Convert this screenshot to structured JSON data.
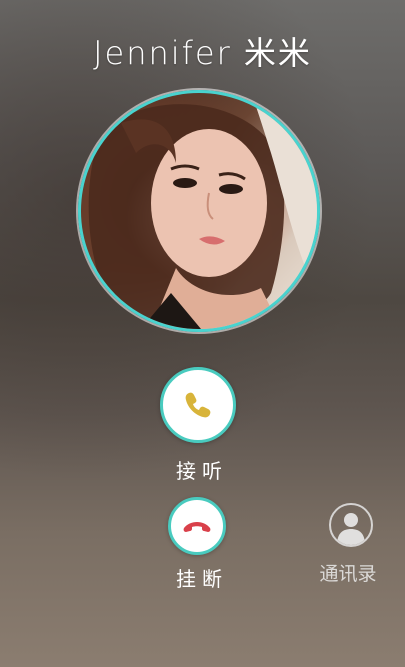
{
  "caller": {
    "name_latin": "Jennifer",
    "name_cjk": "米米"
  },
  "avatar": {
    "icon": "contact-photo"
  },
  "actions": {
    "answer_label": "接听",
    "hangup_label": "挂断",
    "contacts_label": "通讯录"
  },
  "colors": {
    "accent_teal": "#49d3cf",
    "answer_icon": "#d8b43a",
    "hangup_icon": "#d9404a"
  }
}
